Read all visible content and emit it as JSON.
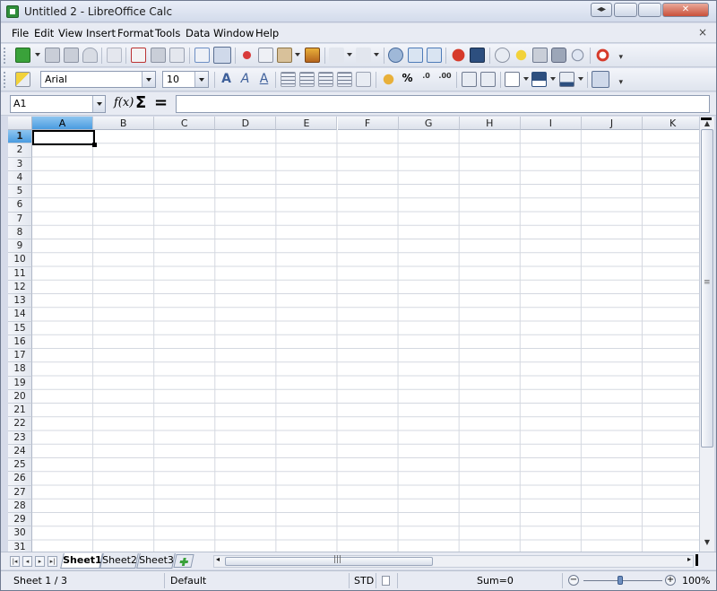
{
  "window": {
    "title": "Untitled 2 - LibreOffice Calc",
    "controls": [
      "◂▸",
      "▭",
      "▢",
      "✕"
    ]
  },
  "menubar": {
    "items": [
      "File",
      "Edit",
      "View",
      "Insert",
      "Format",
      "Tools",
      "Data",
      "Window",
      "Help"
    ],
    "close": "×"
  },
  "toolbar_standard": {
    "icons": [
      "new-document-icon",
      "open-icon",
      "save-icon",
      "email-icon",
      "edit-file-icon",
      "export-pdf-icon",
      "print-icon",
      "print-preview-icon",
      "spellcheck-icon",
      "autospellcheck-icon",
      "cut-icon",
      "copy-icon",
      "paste-icon",
      "clone-formatting-icon",
      "undo-icon",
      "redo-icon",
      "hyperlink-icon",
      "sort-ascending-icon",
      "sort-descending-icon",
      "chart-icon",
      "pivot-table-icon",
      "navigator-icon",
      "gallery-icon",
      "data-sources-icon",
      "zoom-icon",
      "help-icon"
    ],
    "more": "▾"
  },
  "toolbar_formatting": {
    "font_name": "Arial",
    "font_size": "10",
    "number_format_percent": "%",
    "more": "▾"
  },
  "formula_bar": {
    "name_box": "A1",
    "function_wizard": "f(x)",
    "sum": "Σ",
    "equals": "=",
    "content": ""
  },
  "sheet": {
    "columns": [
      "A",
      "B",
      "C",
      "D",
      "E",
      "F",
      "G",
      "H",
      "I",
      "J",
      "K"
    ],
    "rows": [
      "1",
      "2",
      "3",
      "4",
      "5",
      "6",
      "7",
      "8",
      "9",
      "10",
      "11",
      "12",
      "13",
      "14",
      "15",
      "16",
      "17",
      "18",
      "19",
      "20",
      "21",
      "22",
      "23",
      "24",
      "25",
      "26",
      "27",
      "28",
      "29",
      "30",
      "31"
    ],
    "selected_cell": "A1"
  },
  "tabs": {
    "sheets": [
      "Sheet1",
      "Sheet2",
      "Sheet3"
    ],
    "active": "Sheet1",
    "add": "+"
  },
  "statusbar": {
    "sheet_position": "Sheet 1 / 3",
    "page_style": "Default",
    "selection_mode": "STD",
    "sum": "Sum=0",
    "zoom_minus": "−",
    "zoom_plus": "+",
    "zoom": "100%"
  }
}
